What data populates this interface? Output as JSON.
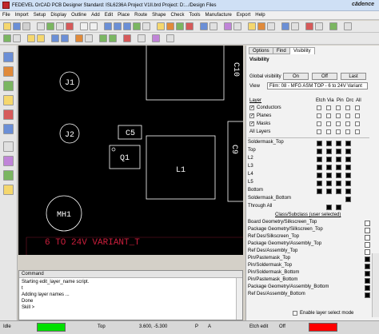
{
  "window": {
    "title": "FEDEVEL OrCAD PCB Designer Standard: ISL6236A Project V1II.brd  Project: D:.../Design Files",
    "brand": "cādence"
  },
  "menu": [
    "File",
    "Import",
    "Setup",
    "Display",
    "Outline",
    "Add",
    "Edit",
    "Place",
    "Route",
    "Shape",
    "Check",
    "Tools",
    "Manufacture",
    "Export",
    "Help"
  ],
  "canvas": {
    "labels": {
      "j1": "J1",
      "j2": "J2",
      "c5": "C5",
      "q1": "Q1",
      "l1": "L1",
      "mh1": "MH1",
      "c10": "C10",
      "c9": "C9",
      "variant": "6 TO 24V VARIANT_T"
    }
  },
  "command": {
    "title": "Command",
    "lines": [
      "Starting edit_layer_name script.",
      "t",
      "Adding layer names ...",
      "Done",
      "Skill >"
    ]
  },
  "status": {
    "mode": "Idle",
    "layer": "Top",
    "coords": "3.600, -5.300",
    "p": "P",
    "a": "A",
    "etch": "Etch edit",
    "off": "Off"
  },
  "panel": {
    "tabs": [
      "Options",
      "Find",
      "Visibility"
    ],
    "section": "Visibility",
    "global_visibility": "Global visibility",
    "on": "On",
    "off": "Off",
    "view_label": "View",
    "view_value": "Film: 08 - MFG ASM TOP - 6 to 24V Variant",
    "layer_header": "Layer",
    "col_headers": [
      "Etch",
      "Via",
      "Pin",
      "Drc",
      "All"
    ],
    "conductors": "Conductors",
    "planes": "Planes",
    "masks": "Masks",
    "all_layers": "All Layers",
    "layers": [
      "Soldermask_Top",
      "Top",
      "L2",
      "L3",
      "L4",
      "L5",
      "Bottom",
      "Soldermask_Bottom",
      "Through All"
    ],
    "subclass_header": "Class/Subclass (user selected)",
    "subclasses": [
      "Board Geometry/Silkscreen_Top",
      "Package Geometry/Silkscreen_Top",
      "Ref Des/Silkscreen_Top",
      "Package Geometry/Assembly_Top",
      "Ref Des/Assembly_Top",
      "Pin/Pastemask_Top",
      "Pin/Soldermask_Top",
      "Pin/Soldermask_Bottom",
      "Pin/Pastemask_Bottom",
      "Package Geometry/Assembly_Bottom",
      "Ref Des/Assembly_Bottom"
    ],
    "enable_select": "Enable layer select mode"
  },
  "colors": {
    "canvas_bg": "#000000",
    "silk": "#ffffff",
    "variant_text": "#cc1e3c",
    "status_green": "#00e000",
    "status_red": "#ff0000"
  }
}
